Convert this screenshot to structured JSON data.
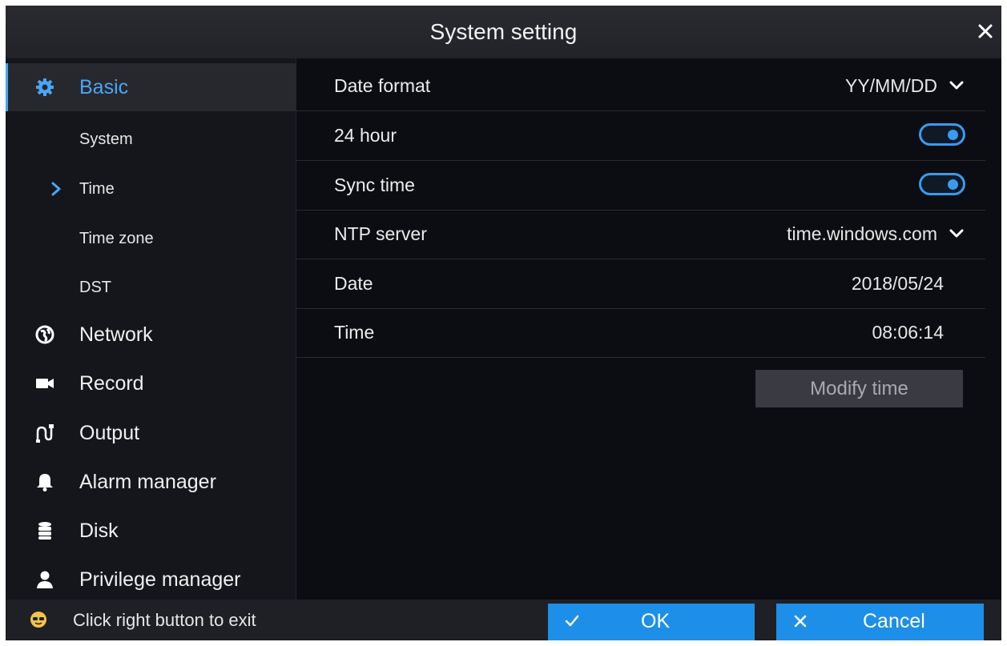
{
  "window": {
    "title": "System setting"
  },
  "sidebar": {
    "items": [
      {
        "label": "Basic",
        "icon": "gear-icon",
        "active": true
      },
      {
        "label": "Network",
        "icon": "globe-icon"
      },
      {
        "label": "Record",
        "icon": "video-camera-icon"
      },
      {
        "label": "Output",
        "icon": "output-icon"
      },
      {
        "label": "Alarm manager",
        "icon": "bell-icon"
      },
      {
        "label": "Disk",
        "icon": "database-icon"
      },
      {
        "label": "Privilege manager",
        "icon": "user-icon"
      }
    ],
    "subitems": [
      {
        "label": "System"
      },
      {
        "label": "Time",
        "selected": true
      },
      {
        "label": "Time zone"
      },
      {
        "label": "DST"
      }
    ]
  },
  "settings": {
    "date_format": {
      "label": "Date format",
      "value": "YY/MM/DD"
    },
    "hour24": {
      "label": "24 hour",
      "enabled": true
    },
    "sync_time": {
      "label": "Sync time",
      "enabled": true
    },
    "ntp_server": {
      "label": "NTP server",
      "value": "time.windows.com"
    },
    "date": {
      "label": "Date",
      "value": "2018/05/24"
    },
    "time": {
      "label": "Time",
      "value": "08:06:14"
    },
    "modify_button": "Modify time"
  },
  "footer": {
    "hint": "Click right button to exit",
    "ok_label": "OK",
    "cancel_label": "Cancel"
  },
  "colors": {
    "accent": "#1d8fe8",
    "active_text": "#4aa6f5",
    "background": "#0c0d12"
  }
}
